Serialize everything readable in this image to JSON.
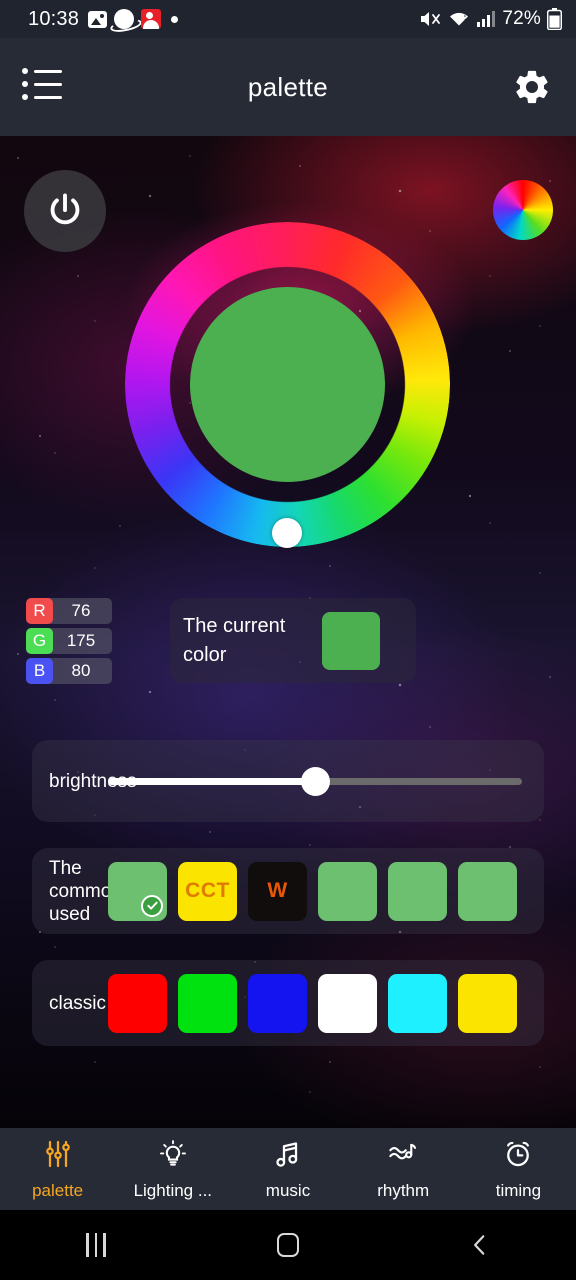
{
  "status_bar": {
    "time": "10:38",
    "left_icons": [
      "photo-icon",
      "planet-icon",
      "red-app-icon",
      "dot-icon"
    ],
    "right_icons": [
      "mute-icon",
      "wifi-icon",
      "signal-icon",
      "battery-icon"
    ],
    "battery_percent": "72%"
  },
  "app_bar": {
    "title": "palette",
    "menu_icon": "list-menu-icon",
    "settings_icon": "gear-icon"
  },
  "controls": {
    "power_icon": "power-icon",
    "color_wheel_icon": "color-wheel-icon"
  },
  "color_ring": {
    "selected_color": "#4CAF50",
    "thumb_position_deg": 180
  },
  "rgb": {
    "rows": [
      {
        "key": "R",
        "value": "76",
        "key_color": "#f24b4b"
      },
      {
        "key": "G",
        "value": "175",
        "key_color": "#4cdd55"
      },
      {
        "key": "B",
        "value": "80",
        "key_color": "#4b52f2"
      }
    ]
  },
  "current_color": {
    "label": "The current color",
    "swatch": "#4CAF50"
  },
  "brightness": {
    "label": "brightness",
    "value": 50
  },
  "commonly_used": {
    "label": "The commonly used",
    "swatches": [
      {
        "color": "#6cc070",
        "text": "",
        "text_color": "",
        "selected": true
      },
      {
        "color": "#fbe400",
        "text": "CCT",
        "text_color": "#e07b00",
        "selected": false
      },
      {
        "color": "#120d0d",
        "text": "W",
        "text_color": "#e8560a",
        "selected": false
      },
      {
        "color": "#6cc070",
        "text": "",
        "text_color": "",
        "selected": false
      },
      {
        "color": "#6cc070",
        "text": "",
        "text_color": "",
        "selected": false
      },
      {
        "color": "#6cc070",
        "text": "",
        "text_color": "",
        "selected": false
      }
    ]
  },
  "classic": {
    "label": "classic",
    "swatches": [
      {
        "color": "#fe0000"
      },
      {
        "color": "#00e210"
      },
      {
        "color": "#1414f0"
      },
      {
        "color": "#ffffff"
      },
      {
        "color": "#1ef0ff"
      },
      {
        "color": "#fbe400"
      }
    ]
  },
  "bottom_nav": {
    "active_color": "#f5a623",
    "items": [
      {
        "label": "palette",
        "icon": "sliders-icon",
        "active": true
      },
      {
        "label": "Lighting ...",
        "icon": "bulb-icon",
        "active": false
      },
      {
        "label": "music",
        "icon": "music-icon",
        "active": false
      },
      {
        "label": "rhythm",
        "icon": "waves-icon",
        "active": false
      },
      {
        "label": "timing",
        "icon": "alarm-icon",
        "active": false
      }
    ]
  },
  "android_nav": {
    "recents_icon": "recents-icon",
    "home_icon": "home-icon",
    "back_icon": "back-icon"
  }
}
